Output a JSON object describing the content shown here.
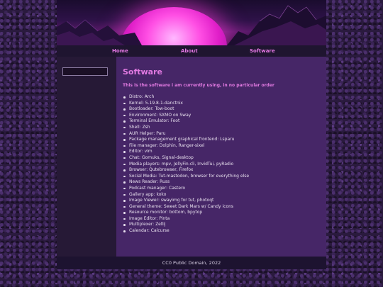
{
  "nav": {
    "home": "Home",
    "about": "About",
    "software": "Software"
  },
  "search": {
    "value": "",
    "placeholder": ""
  },
  "main": {
    "title": "Software",
    "subtitle": "This is the software i am currently using, in no particular order",
    "items": [
      "Distro: Arch",
      "Kernel: 5.19.8-1-danctnix",
      "Bootloader: Tow-boot",
      "Environment: SXMO on Sway",
      "Terminal Emulator: Foot",
      "Shell: Zsh",
      "AUR Helper: Paru",
      "Package management graphical frontend: Lsparu",
      "File manager: Dolphin, Ranger-sixel",
      "Editor: vim",
      "Chat: Gomuks, Signal-desktop",
      "Media players: mpv, JellyFin-cli, InvidTui, pyRadio",
      "Browser: Qutebrowser, Firefox",
      "Social Media: Tut-mastodon, browser for everything else",
      "News Reader: Russ",
      "Podcast manager: Castero",
      "Gallery app: koko",
      "Image Viewer: swayimg for tut, photoqt",
      "General theme: Sweet Dark Mars w/ Candy icons",
      "Resource monitor: bottom, bpytop",
      "Image Editor: Pinta",
      "Multiplexer: Zellij",
      "Calendar: Calcurse"
    ]
  },
  "footer": {
    "text": "CC0 Public Domain, 2022"
  },
  "colors": {
    "accent": "#e27ae2",
    "content_bg": "#462667",
    "nav_bg": "#1f1530",
    "sidebar_bg": "#261936",
    "text": "#e8e0ee"
  },
  "banner": {
    "motif": "synthwave sunset over mountains"
  }
}
